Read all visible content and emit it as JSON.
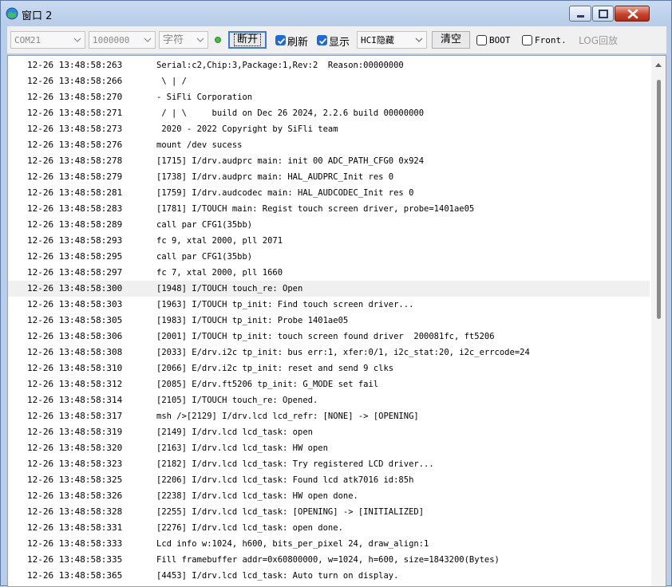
{
  "window": {
    "title": "窗口 2"
  },
  "toolbar": {
    "port": "COM21",
    "baud": "1000000",
    "mode": "字符",
    "connect_label": "断开",
    "refresh_label": "刷新",
    "refresh_checked": true,
    "display_label": "显示",
    "display_checked": true,
    "hci_mode": "HCI隐藏",
    "clear_label": "清空",
    "boot_label": "BOOT",
    "boot_checked": false,
    "front_label": "Front.",
    "front_checked": false,
    "log_playback_label": "LOG回放"
  },
  "log": {
    "selected_index": 14,
    "rows": [
      {
        "ts": "12-26 13:48:58:263",
        "msg": "Serial:c2,Chip:3,Package:1,Rev:2  Reason:00000000"
      },
      {
        "ts": "12-26 13:48:58:266",
        "msg": " \\ | /"
      },
      {
        "ts": "12-26 13:48:58:270",
        "msg": "- SiFli Corporation"
      },
      {
        "ts": "12-26 13:48:58:271",
        "msg": " / | \\     build on Dec 26 2024, 2.2.6 build 00000000"
      },
      {
        "ts": "12-26 13:48:58:273",
        "msg": " 2020 - 2022 Copyright by SiFli team"
      },
      {
        "ts": "12-26 13:48:58:276",
        "msg": "mount /dev sucess"
      },
      {
        "ts": "12-26 13:48:58:278",
        "msg": "[1715] I/drv.audprc main: init 00 ADC_PATH_CFG0 0x924"
      },
      {
        "ts": "12-26 13:48:58:279",
        "msg": "[1738] I/drv.audprc main: HAL_AUDPRC_Init res 0"
      },
      {
        "ts": "12-26 13:48:58:281",
        "msg": "[1759] I/drv.audcodec main: HAL_AUDCODEC_Init res 0"
      },
      {
        "ts": "12-26 13:48:58:283",
        "msg": "[1781] I/TOUCH main: Regist touch screen driver, probe=1401ae05"
      },
      {
        "ts": "12-26 13:48:58:289",
        "msg": "call par CFG1(35bb)"
      },
      {
        "ts": "12-26 13:48:58:293",
        "msg": "fc 9, xtal 2000, pll 2071"
      },
      {
        "ts": "12-26 13:48:58:295",
        "msg": "call par CFG1(35bb)"
      },
      {
        "ts": "12-26 13:48:58:297",
        "msg": "fc 7, xtal 2000, pll 1660"
      },
      {
        "ts": "12-26 13:48:58:300",
        "msg": "[1948] I/TOUCH touch_re: Open"
      },
      {
        "ts": "12-26 13:48:58:303",
        "msg": "[1963] I/TOUCH tp_init: Find touch screen driver..."
      },
      {
        "ts": "12-26 13:48:58:305",
        "msg": "[1983] I/TOUCH tp_init: Probe 1401ae05"
      },
      {
        "ts": "12-26 13:48:58:306",
        "msg": "[2001] I/TOUCH tp_init: touch screen found driver  200081fc, ft5206"
      },
      {
        "ts": "12-26 13:48:58:308",
        "msg": "[2033] E/drv.i2c tp_init: bus err:1, xfer:0/1, i2c_stat:20, i2c_errcode=24"
      },
      {
        "ts": "12-26 13:48:58:310",
        "msg": "[2066] E/drv.i2c tp_init: reset and send 9 clks"
      },
      {
        "ts": "12-26 13:48:58:312",
        "msg": "[2085] E/drv.ft5206 tp_init: G_MODE set fail"
      },
      {
        "ts": "12-26 13:48:58:314",
        "msg": "[2105] I/TOUCH touch_re: Opened."
      },
      {
        "ts": "12-26 13:48:58:317",
        "msg": "msh />[2129] I/drv.lcd lcd_refr: [NONE] -> [OPENING]"
      },
      {
        "ts": "12-26 13:48:58:319",
        "msg": "[2149] I/drv.lcd lcd_task: open"
      },
      {
        "ts": "12-26 13:48:58:320",
        "msg": "[2163] I/drv.lcd lcd_task: HW open"
      },
      {
        "ts": "12-26 13:48:58:323",
        "msg": "[2182] I/drv.lcd lcd_task: Try registered LCD driver..."
      },
      {
        "ts": "12-26 13:48:58:325",
        "msg": "[2206] I/drv.lcd lcd_task: Found lcd atk7016 id:85h"
      },
      {
        "ts": "12-26 13:48:58:326",
        "msg": "[2238] I/drv.lcd lcd_task: HW open done."
      },
      {
        "ts": "12-26 13:48:58:328",
        "msg": "[2255] I/drv.lcd lcd_task: [OPENING] -> [INITIALIZED]"
      },
      {
        "ts": "12-26 13:48:58:331",
        "msg": "[2276] I/drv.lcd lcd_task: open done."
      },
      {
        "ts": "12-26 13:48:58:333",
        "msg": "Lcd info w:1024, h600, bits_per_pixel 24, draw_align:1"
      },
      {
        "ts": "12-26 13:48:58:335",
        "msg": "Fill framebuffer addr=0x60800000, w=1024, h=600, size=1843200(Bytes)"
      },
      {
        "ts": "12-26 13:48:58:365",
        "msg": "[4453] I/drv.lcd lcd_task: Auto turn on display."
      }
    ]
  }
}
